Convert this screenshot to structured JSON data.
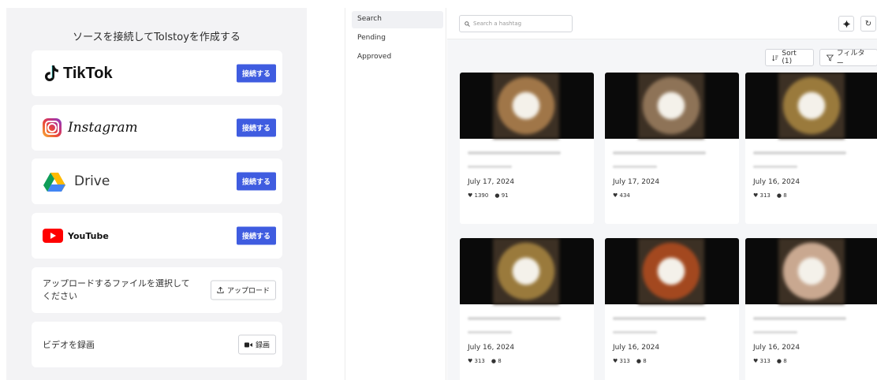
{
  "sources_panel": {
    "title": "ソースを接続してTolstoyを作成する",
    "connect_label": "接続する",
    "tiktok": {
      "name": "TikTok"
    },
    "instagram": {
      "name": "Instagram"
    },
    "drive": {
      "name": "Drive"
    },
    "youtube": {
      "name": "YouTube"
    },
    "upload": {
      "text": "アップロードするファイルを選択してください",
      "button": "アップロード"
    },
    "record": {
      "text": "ビデオを録画",
      "button": "録画"
    }
  },
  "hashtag": {
    "nav": [
      {
        "label": "Search",
        "active": true
      },
      {
        "label": "Pending",
        "active": false
      },
      {
        "label": "Approved",
        "active": false
      }
    ],
    "search_placeholder": "Search a hashtag",
    "sort_label": "Sort (1)",
    "filter_label": "フィルター",
    "icons": [
      "gear-icon",
      "refresh-icon",
      "sort-icon",
      "filter-icon",
      "search-icon"
    ],
    "videos": [
      {
        "date": "July 17, 2024",
        "likes": "1390",
        "comments": "91",
        "thumb_color": "#a07648"
      },
      {
        "date": "July 17, 2024",
        "likes": "434",
        "comments": "",
        "thumb_color": "#8e7357"
      },
      {
        "date": "July 16, 2024",
        "likes": "313",
        "comments": "8",
        "thumb_color": "#9a7a3c"
      },
      {
        "date": "July 16, 2024",
        "likes": "313",
        "comments": "8",
        "thumb_color": "#9a7a3c"
      },
      {
        "date": "July 16, 2024",
        "likes": "313",
        "comments": "8",
        "thumb_color": "#a3481f"
      },
      {
        "date": "July 16, 2024",
        "likes": "313",
        "comments": "8",
        "thumb_color": "#c9a890"
      }
    ]
  },
  "colors": {
    "accent": "#3f5ce0",
    "panel_bg": "#f3f3f5",
    "main_bg": "#f5f6f8"
  }
}
